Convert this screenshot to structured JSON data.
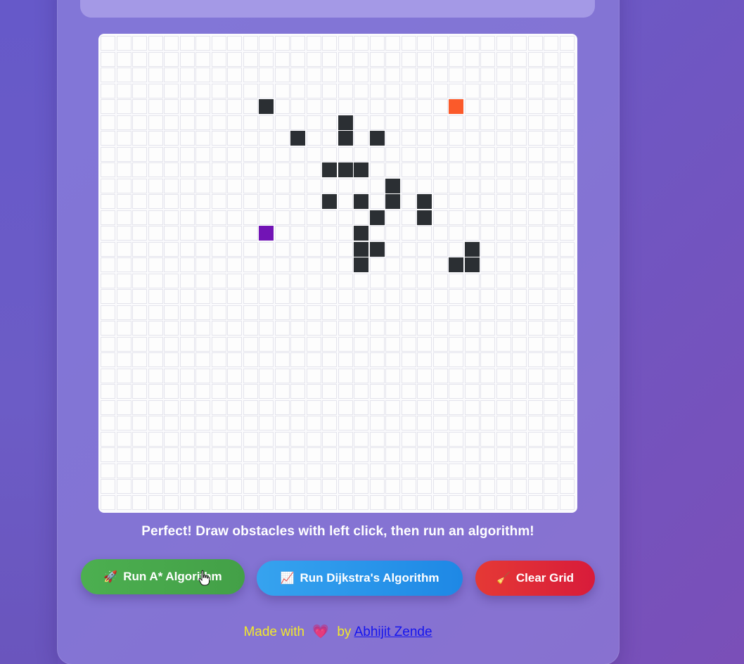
{
  "grid": {
    "columns": 30,
    "rows": 30,
    "walls": [
      [
        10,
        4
      ],
      [
        15,
        5
      ],
      [
        12,
        6
      ],
      [
        15,
        6
      ],
      [
        17,
        6
      ],
      [
        14,
        8
      ],
      [
        15,
        8
      ],
      [
        16,
        8
      ],
      [
        18,
        9
      ],
      [
        14,
        10
      ],
      [
        16,
        10
      ],
      [
        18,
        10
      ],
      [
        20,
        10
      ],
      [
        17,
        11
      ],
      [
        20,
        11
      ],
      [
        16,
        12
      ],
      [
        16,
        13
      ],
      [
        17,
        13
      ],
      [
        23,
        13
      ],
      [
        16,
        14
      ],
      [
        22,
        14
      ],
      [
        23,
        14
      ]
    ],
    "start": [
      10,
      12
    ],
    "end": [
      22,
      4
    ],
    "colors": {
      "wall": "#2b2f33",
      "start": "#7214b5",
      "end": "#fb5a2a",
      "empty": "#fdfdfd"
    }
  },
  "status_message": "Perfect! Draw obstacles with left click, then run an algorithm!",
  "buttons": {
    "astar": {
      "icon": "rocket-icon",
      "emoji": "🚀",
      "label": "Run A* Algorithm"
    },
    "dijkstra": {
      "icon": "chart-icon",
      "emoji": "📈",
      "label": "Run Dijkstra's Algorithm"
    },
    "clear": {
      "icon": "broom-icon",
      "emoji": "🧹",
      "label": "Clear Grid"
    }
  },
  "footer": {
    "made_with": "Made with",
    "heart": "💗",
    "by": "by",
    "author": "Abhijit Zende"
  }
}
